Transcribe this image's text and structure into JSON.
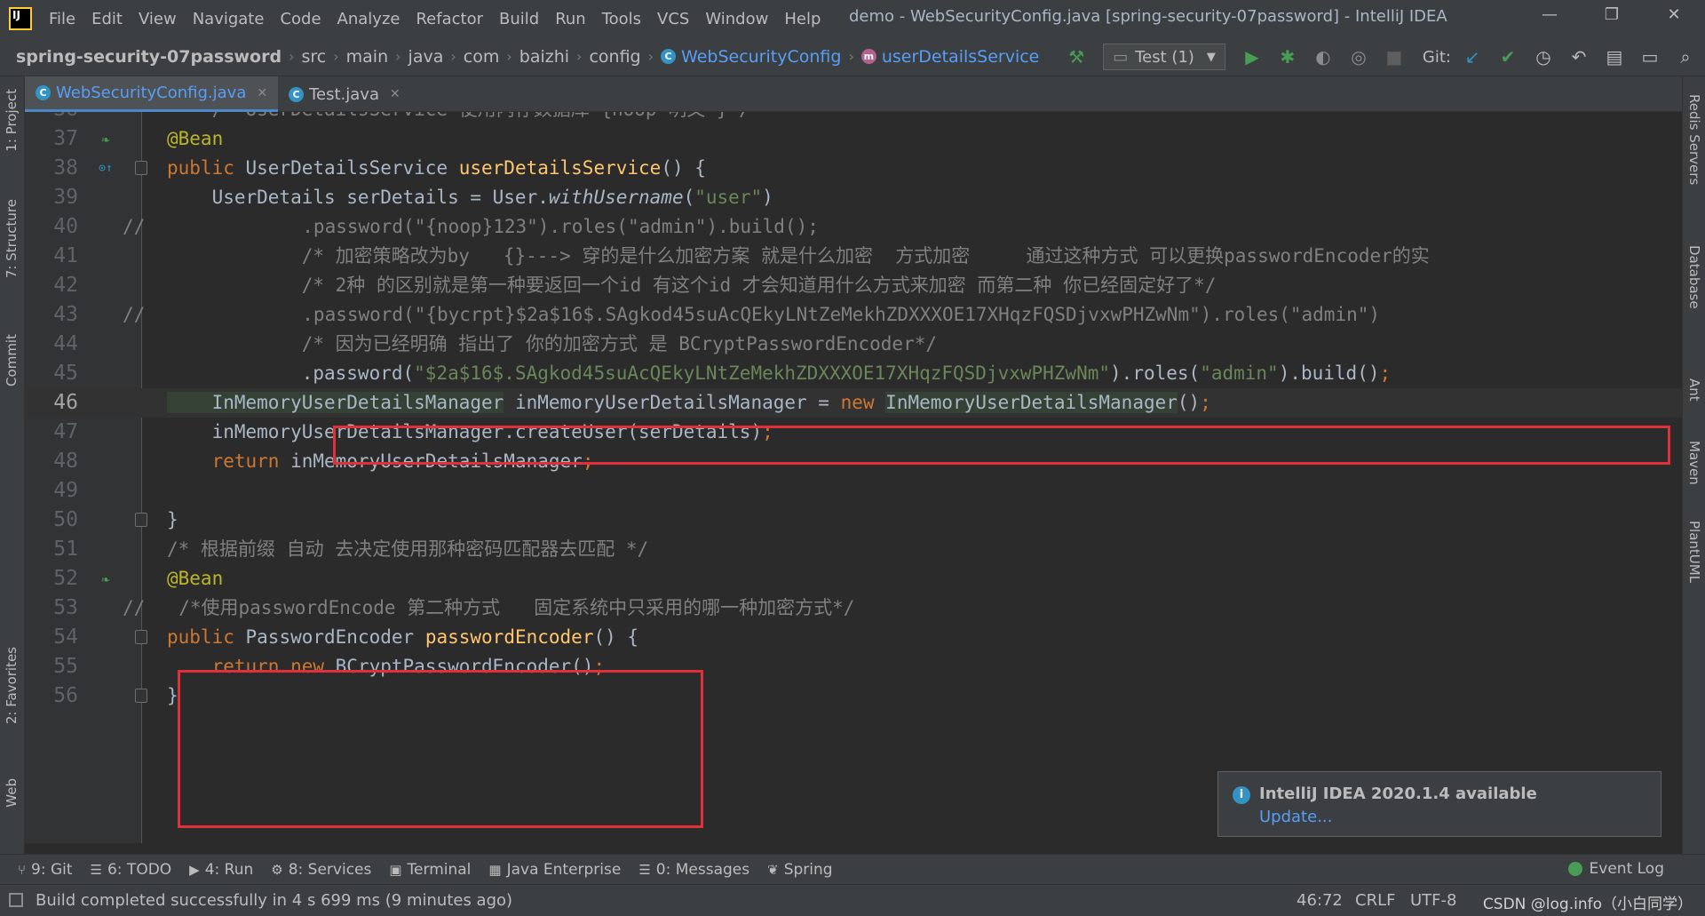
{
  "window": {
    "title": "demo - WebSecurityConfig.java [spring-security-07password] - IntelliJ IDEA",
    "minimize": "—",
    "restore": "❐",
    "close": "✕"
  },
  "menu": [
    "File",
    "Edit",
    "View",
    "Navigate",
    "Code",
    "Analyze",
    "Refactor",
    "Build",
    "Run",
    "Tools",
    "VCS",
    "Window",
    "Help"
  ],
  "breadcrumb": {
    "project": "spring-security-07password",
    "parts": [
      "src",
      "main",
      "java",
      "com",
      "baizhi",
      "config"
    ],
    "class_badge": "C",
    "class": "WebSecurityConfig",
    "method_badge": "m",
    "method": "userDetailsService"
  },
  "toolbar": {
    "run_config": "Test (1)",
    "git_label": "Git:"
  },
  "left_tools": [
    "1: Project",
    "7: Structure",
    "Commit",
    "2: Favorites",
    "Web"
  ],
  "right_tools": [
    "Redis Servers",
    "Database",
    "Ant",
    "Maven",
    "PlantUML"
  ],
  "tabs": [
    {
      "label": "WebSecurityConfig.java",
      "badge": "C",
      "active": true
    },
    {
      "label": "Test.java",
      "badge": "C",
      "active": false
    }
  ],
  "code": {
    "current_line": 46,
    "lines": [
      {
        "n": "36",
        "segs": [
          {
            "c": "cmt",
            "t": "    /* UserDetailsService 使用内存数据库 {noop 明文 }*/"
          }
        ]
      },
      {
        "n": "37",
        "icon": "bean",
        "segs": [
          {
            "c": "ann",
            "t": "@Bean"
          }
        ]
      },
      {
        "n": "38",
        "icon": "override",
        "fold": true,
        "segs": [
          {
            "c": "kw",
            "t": "public "
          },
          {
            "c": "id",
            "t": "UserDetailsService "
          },
          {
            "c": "fn",
            "t": "userDetailsService"
          },
          {
            "c": "id",
            "t": "() {"
          }
        ]
      },
      {
        "n": "39",
        "segs": [
          {
            "c": "id",
            "t": "    UserDetails serDetails = User."
          },
          {
            "c": "id it",
            "t": "withUsername"
          },
          {
            "c": "id",
            "t": "("
          },
          {
            "c": "str",
            "t": "\"user\""
          },
          {
            "c": "id",
            "t": ")"
          }
        ]
      },
      {
        "n": "40",
        "segs": [
          {
            "c": "cmt",
            "t": "//              .password(\"{noop}123\").roles(\"admin\").build();"
          }
        ],
        "indent_comment": true
      },
      {
        "n": "41",
        "segs": [
          {
            "c": "cmt",
            "t": "            /* 加密策略改为by   {}---> 穿的是什么加密方案 就是什么加密  方式加密     通过这种方式 可以更换passwordEncoder的实"
          }
        ]
      },
      {
        "n": "42",
        "segs": [
          {
            "c": "cmt",
            "t": "            /* 2种 的区别就是第一种要返回一个id 有这个id 才会知道用什么方式来加密 而第二种 你已经固定好了*/"
          }
        ]
      },
      {
        "n": "43",
        "segs": [
          {
            "c": "cmt",
            "t": "//              .password(\"{bycrpt}$2a$16$.SAgkod45suAcQEkyLNtZeMekhZDXXXOE17XHqzFQSDjvxwPHZwNm\").roles(\"admin\")"
          }
        ],
        "indent_comment": true
      },
      {
        "n": "44",
        "segs": [
          {
            "c": "cmt",
            "t": "            /* 因为已经明确 指出了 你的加密方式 是 BCryptPasswordEncoder*/"
          }
        ]
      },
      {
        "n": "45",
        "segs": [
          {
            "c": "id",
            "t": "            .password("
          },
          {
            "c": "str",
            "t": "\"$2a$16$.SAgkod45suAcQEkyLNtZeMekhZDXXXOE17XHqzFQSDjvxwPHZwNm\""
          },
          {
            "c": "id",
            "t": ").roles("
          },
          {
            "c": "str",
            "t": "\"admin\""
          },
          {
            "c": "id",
            "t": ").build()"
          },
          {
            "c": "kw",
            "t": ";"
          }
        ]
      },
      {
        "n": "46",
        "segs": [
          {
            "c": "id hl",
            "t": "    InMemoryUserDetailsManager"
          },
          {
            "c": "id",
            "t": " inMemoryUserDetailsManager = "
          },
          {
            "c": "kw",
            "t": "new "
          },
          {
            "c": "id hl",
            "t": "InMemoryUserDetailsManager"
          },
          {
            "c": "id",
            "t": "()"
          },
          {
            "c": "kw",
            "t": ";"
          }
        ]
      },
      {
        "n": "47",
        "segs": [
          {
            "c": "id",
            "t": "    inMemoryUserDetailsManager.createUser(serDetails)"
          },
          {
            "c": "kw",
            "t": ";"
          }
        ]
      },
      {
        "n": "48",
        "segs": [
          {
            "c": "kw",
            "t": "    return "
          },
          {
            "c": "id",
            "t": "inMemoryUserDetailsManager"
          },
          {
            "c": "kw",
            "t": ";"
          }
        ]
      },
      {
        "n": "49",
        "segs": [
          {
            "c": "id",
            "t": ""
          }
        ]
      },
      {
        "n": "50",
        "fold": true,
        "segs": [
          {
            "c": "id",
            "t": "}"
          }
        ]
      },
      {
        "n": "51",
        "segs": [
          {
            "c": "cmt",
            "t": "/* 根据前缀 自动 去决定使用那种密码匹配器去匹配 */"
          }
        ]
      },
      {
        "n": "52",
        "icon": "bean",
        "segs": [
          {
            "c": "ann",
            "t": "@Bean"
          }
        ]
      },
      {
        "n": "53",
        "segs": [
          {
            "c": "cmt",
            "t": "//   /*使用passwordEncode 第二种方式   固定系统中只采用的哪一种加密方式*/"
          }
        ],
        "indent_comment": true
      },
      {
        "n": "54",
        "fold": true,
        "segs": [
          {
            "c": "kw",
            "t": "public "
          },
          {
            "c": "id",
            "t": "PasswordEncoder "
          },
          {
            "c": "fn",
            "t": "passwordEncoder"
          },
          {
            "c": "id",
            "t": "() {"
          }
        ]
      },
      {
        "n": "55",
        "segs": [
          {
            "c": "kw",
            "t": "    return new "
          },
          {
            "c": "id",
            "t": "BCryptPasswordEncoder()"
          },
          {
            "c": "kw",
            "t": ";"
          }
        ]
      },
      {
        "n": "56",
        "fold": true,
        "segs": [
          {
            "c": "id",
            "t": "}"
          }
        ]
      }
    ]
  },
  "notification": {
    "title": "IntelliJ IDEA 2020.1.4 available",
    "link": "Update..."
  },
  "bottom_tools": [
    {
      "label": "9: Git",
      "icon": "⑂"
    },
    {
      "label": "6: TODO",
      "icon": "☰"
    },
    {
      "label": "4: Run",
      "icon": "▶"
    },
    {
      "label": "8: Services",
      "icon": "⚙"
    },
    {
      "label": "Terminal",
      "icon": "▣"
    },
    {
      "label": "Java Enterprise",
      "icon": "▦"
    },
    {
      "label": "0: Messages",
      "icon": "☰"
    },
    {
      "label": "Spring",
      "icon": "❦"
    }
  ],
  "event_log": "Event Log",
  "status": {
    "message": "Build completed successfully in 4 s 699 ms (9 minutes ago)",
    "position": "46:72",
    "line_sep": "CRLF",
    "encoding": "UTF-8",
    "watermark": "CSDN @log.info（小白同学）"
  },
  "colors": {
    "accent": "#589df6",
    "highlight_box": "#e0303a",
    "keyword": "#cc7832",
    "string": "#6a8759",
    "comment": "#808080",
    "annotation": "#bbb529",
    "function": "#ffc66d"
  }
}
